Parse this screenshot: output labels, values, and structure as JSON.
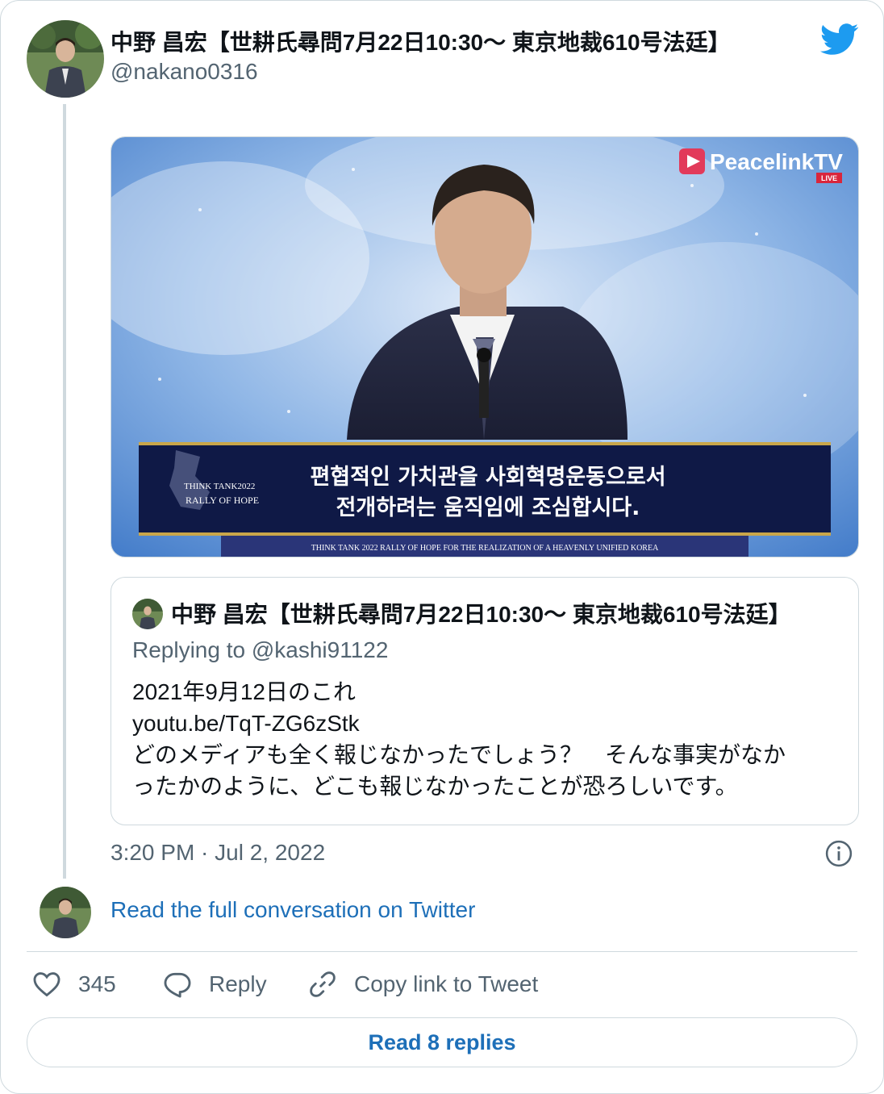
{
  "tweet": {
    "author_name": "中野 昌宏【世耕氏尋問7月22日10:30〜 東京地裁610号法廷】",
    "author_handle": "@nakano0316",
    "timestamp": "3:20 PM · Jul 2, 2022"
  },
  "media": {
    "logo_text": "PeacelinkTV",
    "logo_badge": "LIVE",
    "caption_line1": "편협적인 가치관을 사회혁명운동으로서",
    "caption_line2": "전개하려는 움직임에 조심합시다.",
    "left_logo_line1": "THINK TANK2022",
    "left_logo_line2": "RALLY OF HOPE",
    "ticker": "THINK TANK 2022 RALLY OF HOPE FOR THE REALIZATION OF A HEAVENLY UNIFIED KOREA"
  },
  "quote": {
    "author_name": "中野 昌宏【世耕氏尋問7月22日10:30〜 東京地裁610号法廷】",
    "replying_to": "Replying to @kashi91122",
    "text": "2021年9月12日のこれ\nyoutu.be/TqT-ZG6zStk\nどのメディアも全く報じなかったでしょう？　そんな事実がなか\nったかのように、どこも報じなかったことが恐ろしいです。"
  },
  "links": {
    "read_full": "Read the full conversation on Twitter"
  },
  "actions": {
    "likes": "345",
    "reply": "Reply",
    "copy_link": "Copy link to Tweet"
  },
  "buttons": {
    "read_replies": "Read 8 replies"
  },
  "colors": {
    "twitter_blue": "#1d9bf0",
    "link_blue": "#1d6fb8",
    "muted": "#536471"
  },
  "icons": [
    "twitter-bird-icon",
    "info-icon",
    "heart-icon",
    "reply-icon",
    "link-icon"
  ]
}
